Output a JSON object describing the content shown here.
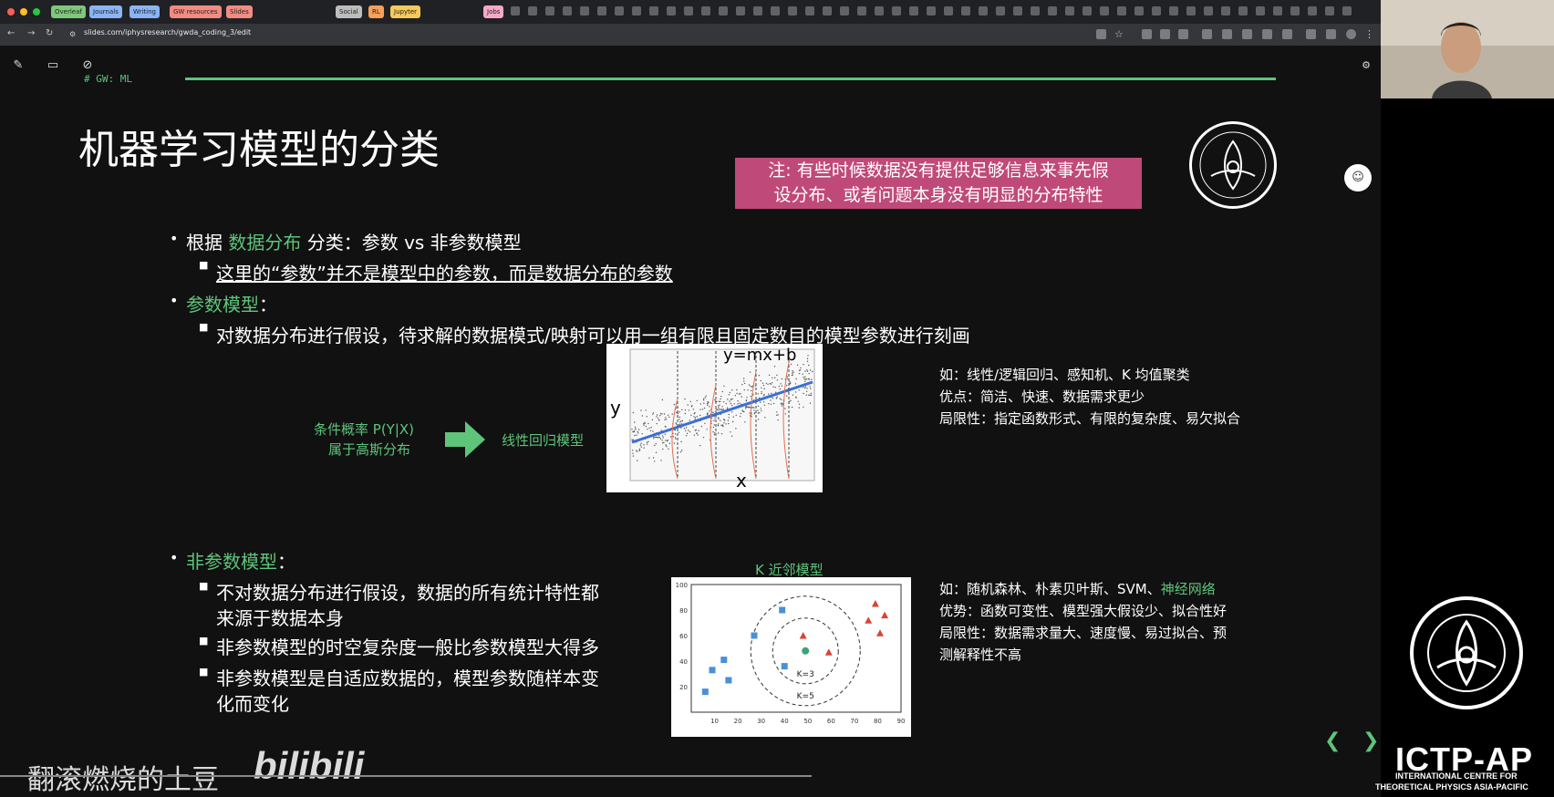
{
  "browser": {
    "tabs": [
      "Overleaf",
      "Journals",
      "Writing",
      "GW resources",
      "Slides",
      "Social",
      "RL",
      "Jupyter",
      "Jobs"
    ],
    "tab_colors": [
      "#7ec87a",
      "#8ab4f8",
      "#8ab4f8",
      "#f28b82",
      "#f28b82",
      "#bdbdbd",
      "#f6a05a",
      "#f6ca5a",
      "#f7a8c8"
    ],
    "url": "slides.com/iphysresearch/gwda_coding_3/edit"
  },
  "slide": {
    "tag": "# GW: ML",
    "title": "机器学习模型的分类",
    "note": [
      "注: 有些时候数据没有提供足够信息来事先假",
      "设分布、或者问题本身没有明显的分布特性"
    ],
    "b1_pre": "根据 ",
    "b1_green": "数据分布",
    "b1_post": " 分类：参数 vs 非参数模型",
    "b1_sub": "这里的“参数”并不是模型中的参数，而是数据分布的参数",
    "b2_green": "参数模型",
    "b2_colon": "：",
    "b2_sub": "对数据分布进行假设，待求解的数据模式/映射可以用一组有限且固定数目的模型参数进行刻画",
    "cond_prob_1": "条件概率 P(Y|X)",
    "cond_prob_2": "属于高斯分布",
    "linreg_label": "线性回归模型",
    "param_notes": [
      "如：线性/逻辑回归、感知机、K 均值聚类",
      "优点：简洁、快速、数据需求更少",
      "局限性：指定函数形式、有限的复杂度、易欠拟合"
    ],
    "b3_green": "非参数模型",
    "b3_colon": "：",
    "b3_subs": [
      "不对数据分布进行假设，数据的所有统计特性都",
      "来源于数据本身",
      "非参数模型的时空复杂度一般比参数模型大得多",
      "非参数模型是自适应数据的，模型参数随样本变",
      "化而变化"
    ],
    "knn_title": "K 近邻模型",
    "nonparam_notes_prefix": "如：随机森林、朴素贝叶斯、SVM、",
    "nonparam_notes_green": "神经网络",
    "nonparam_notes": [
      "优势：函数可变性、模型强大假设少、拟合性好",
      "局限性：数据需求量大、速度慢、易过拟合、预",
      "测解释性不高"
    ]
  },
  "linreg_plot": {
    "eq": "y=mx+b",
    "ylabel": "y",
    "xlabel": "x"
  },
  "chart_data": {
    "type": "scatter",
    "title": "K 近邻模型",
    "xlim": [
      0,
      90
    ],
    "ylim": [
      0,
      100
    ],
    "xticks": [
      "10",
      "20",
      "30",
      "40",
      "50",
      "60",
      "70",
      "80",
      "90"
    ],
    "yticks": [
      "20",
      "40",
      "60",
      "80",
      "100"
    ],
    "series": [
      {
        "marker": "square",
        "color": "#4a90d9",
        "points": [
          [
            6,
            16
          ],
          [
            9,
            33
          ],
          [
            14,
            41
          ],
          [
            16,
            25
          ],
          [
            27,
            60
          ],
          [
            39,
            80
          ],
          [
            40,
            36
          ]
        ]
      },
      {
        "marker": "triangle",
        "color": "#d64535",
        "points": [
          [
            48,
            60
          ],
          [
            59,
            47
          ],
          [
            76,
            72
          ],
          [
            79,
            85
          ],
          [
            81,
            62
          ],
          [
            83,
            76
          ]
        ]
      },
      {
        "marker": "circle",
        "color": "#3aa37a",
        "points": [
          [
            49,
            48
          ]
        ]
      }
    ],
    "annotations": [
      "K=3",
      "K=5"
    ]
  },
  "watermark": {
    "user": "翻滚燃烧的土豆",
    "site": "bilibili"
  },
  "ictp": {
    "name": "ICTP-AP",
    "sub1": "INTERNATIONAL CENTRE FOR",
    "sub2": "THEORETICAL PHYSICS ASIA-PACIFIC"
  }
}
